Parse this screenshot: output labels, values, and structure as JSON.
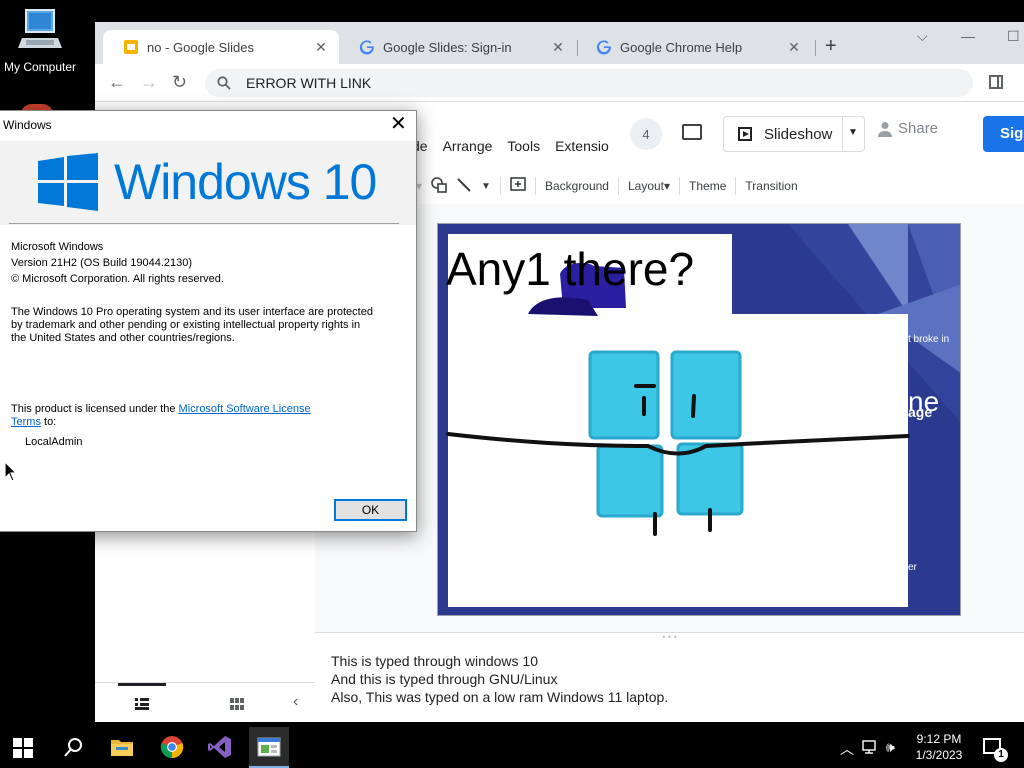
{
  "desktop": {
    "icons": [
      {
        "label": "My Computer",
        "icon": "computer-icon"
      }
    ]
  },
  "browser": {
    "tabs": [
      {
        "title": "no - Google Slides",
        "favicon": "slides-icon",
        "active": true
      },
      {
        "title": "Google Slides: Sign-in",
        "favicon": "google-g-icon",
        "active": false
      },
      {
        "title": "Google Chrome Help",
        "favicon": "google-g-icon",
        "active": false
      }
    ],
    "new_tab": "+",
    "address": "ERROR WITH LINK"
  },
  "slides": {
    "menu": [
      "de",
      "Arrange",
      "Tools",
      "Extensio"
    ],
    "collaborators": "4",
    "slideshow_label": "Slideshow",
    "share_label": "Share",
    "sign_in_label": "Sig",
    "toolbar": {
      "background": "Background",
      "layout": "Layout",
      "theme": "Theme",
      "transition": "Transition"
    },
    "slide": {
      "title": "Any1 there?",
      "fragments": {
        "right_top": "t broke in",
        "right_big": "ne",
        "right_sub": "age",
        "right_bottom": "er"
      }
    },
    "notes": [
      "This is typed through windows 10",
      "And this is typed through GNU/Linux",
      "Also, This was typed on a low ram Windows 11 laptop."
    ]
  },
  "about_dialog": {
    "title": "Windows",
    "brand": "Windows 10",
    "product": "Microsoft Windows",
    "version": "Version 21H2 (OS Build 19044.2130)",
    "copyright": "© Microsoft Corporation. All rights reserved.",
    "legal": [
      "The Windows 10 Pro operating system and its user interface are protected",
      "by trademark and other pending or existing intellectual property rights in",
      "the United States and other countries/regions."
    ],
    "license_prefix": "This product is licensed under the ",
    "license_link_1": "Microsoft Software License",
    "license_link_2": "Terms",
    "license_suffix": " to:",
    "licensee": "LocalAdmin",
    "ok_label": "OK"
  },
  "taskbar": {
    "time": "9:12 PM",
    "date": "1/3/2023",
    "notifications": "1",
    "colors": {
      "accent": "#0078d7",
      "brand_blue": "#1a73e8",
      "slide_blue": "#2b3a8f",
      "doodle_cyan": "#3ec6e6"
    }
  }
}
